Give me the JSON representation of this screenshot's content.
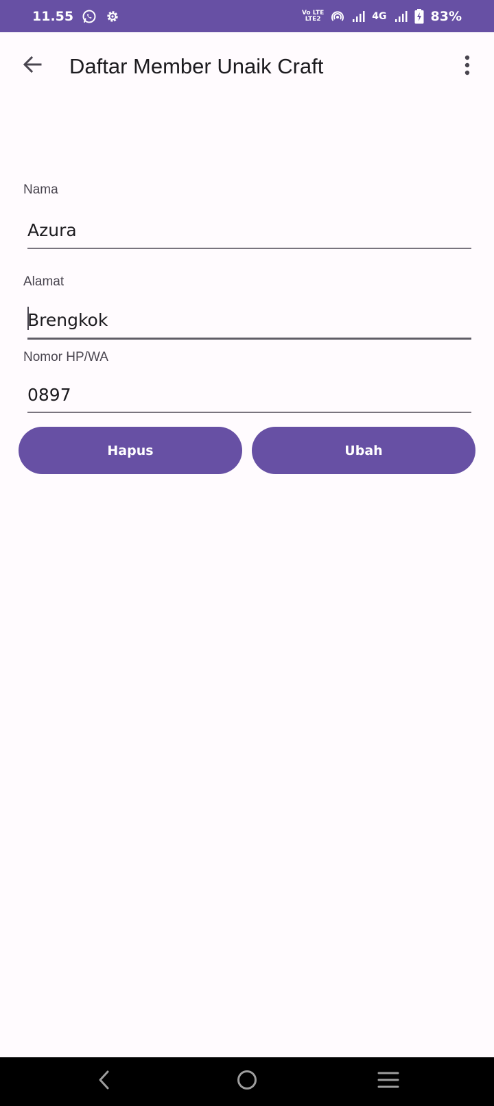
{
  "status_bar": {
    "time": "11.55",
    "volte_top": "Vo LTE",
    "volte_bottom": "LTE2",
    "network": "4G",
    "battery": "83%"
  },
  "app_bar": {
    "title": "Daftar Member Unaik Craft"
  },
  "form": {
    "nama": {
      "label": "Nama",
      "value": "Azura"
    },
    "alamat": {
      "label": "Alamat",
      "value": "Brengkok"
    },
    "nomor": {
      "label": "Nomor HP/WA",
      "value": "0897"
    }
  },
  "actions": {
    "hapus_label": "Hapus",
    "ubah_label": "Ubah"
  },
  "colors": {
    "primary": "#6750a4",
    "background": "#fffbfe",
    "nav_bar": "#000000"
  },
  "icons": {
    "back": "arrow-back-icon",
    "more": "more-vert-icon",
    "whatsapp": "whatsapp-icon",
    "settings": "gear-icon",
    "hotspot": "hotspot-icon",
    "signal": "signal-icon",
    "battery": "battery-charging-icon",
    "nav_back": "nav-back-icon",
    "nav_home": "nav-home-icon",
    "nav_recents": "nav-recents-icon"
  }
}
